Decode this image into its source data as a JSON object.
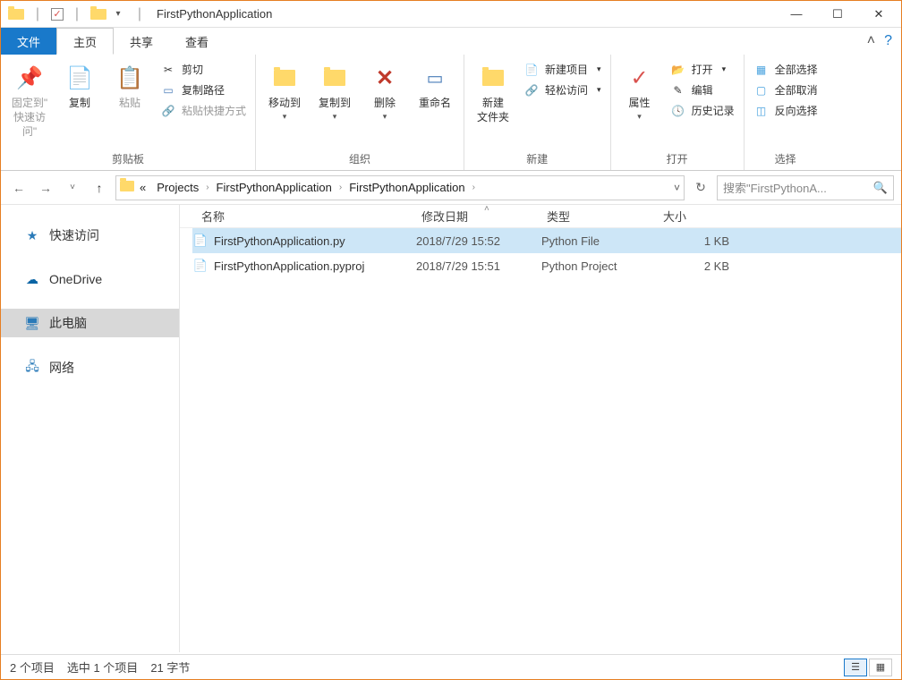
{
  "title": "FirstPythonApplication",
  "tabs": {
    "file": "文件",
    "home": "主页",
    "share": "共享",
    "view": "查看"
  },
  "ribbon": {
    "clipboard": {
      "label": "剪贴板",
      "pin": "固定到\"\n快速访问\"",
      "copy": "复制",
      "paste": "粘贴",
      "cut": "剪切",
      "copypath": "复制路径",
      "shortcut": "粘贴快捷方式"
    },
    "organize": {
      "label": "组织",
      "moveTo": "移动到",
      "copyTo": "复制到",
      "delete": "删除",
      "rename": "重命名"
    },
    "new": {
      "label": "新建",
      "newFolder": "新建\n文件夹",
      "newItem": "新建项目",
      "easyAccess": "轻松访问"
    },
    "open": {
      "label": "打开",
      "properties": "属性",
      "open": "打开",
      "edit": "编辑",
      "history": "历史记录"
    },
    "select": {
      "label": "选择",
      "selectAll": "全部选择",
      "selectNone": "全部取消",
      "invert": "反向选择"
    }
  },
  "breadcrumb": {
    "ellipsis": "«",
    "parts": [
      "Projects",
      "FirstPythonApplication",
      "FirstPythonApplication"
    ]
  },
  "search": {
    "placeholder": "搜索\"FirstPythonA..."
  },
  "sidebar": {
    "quick": "快速访问",
    "onedrive": "OneDrive",
    "thispc": "此电脑",
    "network": "网络"
  },
  "columns": {
    "name": "名称",
    "date": "修改日期",
    "type": "类型",
    "size": "大小"
  },
  "files": [
    {
      "name": "FirstPythonApplication.py",
      "date": "2018/7/29 15:52",
      "type": "Python File",
      "size": "1 KB",
      "selected": true
    },
    {
      "name": "FirstPythonApplication.pyproj",
      "date": "2018/7/29 15:51",
      "type": "Python Project",
      "size": "2 KB",
      "selected": false
    }
  ],
  "status": {
    "count": "2 个项目",
    "selected": "选中 1 个项目",
    "bytes": "21 字节"
  }
}
